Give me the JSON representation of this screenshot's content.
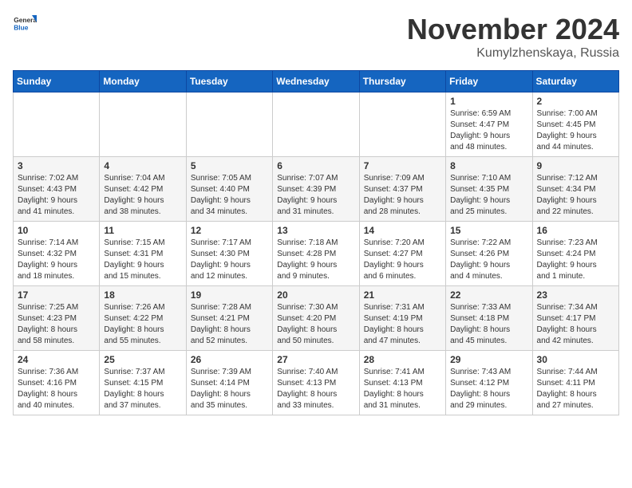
{
  "header": {
    "logo_general": "General",
    "logo_blue": "Blue",
    "month": "November 2024",
    "location": "Kumylzhenskaya, Russia"
  },
  "days_of_week": [
    "Sunday",
    "Monday",
    "Tuesday",
    "Wednesday",
    "Thursday",
    "Friday",
    "Saturday"
  ],
  "weeks": [
    [
      {
        "day": "",
        "info": ""
      },
      {
        "day": "",
        "info": ""
      },
      {
        "day": "",
        "info": ""
      },
      {
        "day": "",
        "info": ""
      },
      {
        "day": "",
        "info": ""
      },
      {
        "day": "1",
        "info": "Sunrise: 6:59 AM\nSunset: 4:47 PM\nDaylight: 9 hours\nand 48 minutes."
      },
      {
        "day": "2",
        "info": "Sunrise: 7:00 AM\nSunset: 4:45 PM\nDaylight: 9 hours\nand 44 minutes."
      }
    ],
    [
      {
        "day": "3",
        "info": "Sunrise: 7:02 AM\nSunset: 4:43 PM\nDaylight: 9 hours\nand 41 minutes."
      },
      {
        "day": "4",
        "info": "Sunrise: 7:04 AM\nSunset: 4:42 PM\nDaylight: 9 hours\nand 38 minutes."
      },
      {
        "day": "5",
        "info": "Sunrise: 7:05 AM\nSunset: 4:40 PM\nDaylight: 9 hours\nand 34 minutes."
      },
      {
        "day": "6",
        "info": "Sunrise: 7:07 AM\nSunset: 4:39 PM\nDaylight: 9 hours\nand 31 minutes."
      },
      {
        "day": "7",
        "info": "Sunrise: 7:09 AM\nSunset: 4:37 PM\nDaylight: 9 hours\nand 28 minutes."
      },
      {
        "day": "8",
        "info": "Sunrise: 7:10 AM\nSunset: 4:35 PM\nDaylight: 9 hours\nand 25 minutes."
      },
      {
        "day": "9",
        "info": "Sunrise: 7:12 AM\nSunset: 4:34 PM\nDaylight: 9 hours\nand 22 minutes."
      }
    ],
    [
      {
        "day": "10",
        "info": "Sunrise: 7:14 AM\nSunset: 4:32 PM\nDaylight: 9 hours\nand 18 minutes."
      },
      {
        "day": "11",
        "info": "Sunrise: 7:15 AM\nSunset: 4:31 PM\nDaylight: 9 hours\nand 15 minutes."
      },
      {
        "day": "12",
        "info": "Sunrise: 7:17 AM\nSunset: 4:30 PM\nDaylight: 9 hours\nand 12 minutes."
      },
      {
        "day": "13",
        "info": "Sunrise: 7:18 AM\nSunset: 4:28 PM\nDaylight: 9 hours\nand 9 minutes."
      },
      {
        "day": "14",
        "info": "Sunrise: 7:20 AM\nSunset: 4:27 PM\nDaylight: 9 hours\nand 6 minutes."
      },
      {
        "day": "15",
        "info": "Sunrise: 7:22 AM\nSunset: 4:26 PM\nDaylight: 9 hours\nand 4 minutes."
      },
      {
        "day": "16",
        "info": "Sunrise: 7:23 AM\nSunset: 4:24 PM\nDaylight: 9 hours\nand 1 minute."
      }
    ],
    [
      {
        "day": "17",
        "info": "Sunrise: 7:25 AM\nSunset: 4:23 PM\nDaylight: 8 hours\nand 58 minutes."
      },
      {
        "day": "18",
        "info": "Sunrise: 7:26 AM\nSunset: 4:22 PM\nDaylight: 8 hours\nand 55 minutes."
      },
      {
        "day": "19",
        "info": "Sunrise: 7:28 AM\nSunset: 4:21 PM\nDaylight: 8 hours\nand 52 minutes."
      },
      {
        "day": "20",
        "info": "Sunrise: 7:30 AM\nSunset: 4:20 PM\nDaylight: 8 hours\nand 50 minutes."
      },
      {
        "day": "21",
        "info": "Sunrise: 7:31 AM\nSunset: 4:19 PM\nDaylight: 8 hours\nand 47 minutes."
      },
      {
        "day": "22",
        "info": "Sunrise: 7:33 AM\nSunset: 4:18 PM\nDaylight: 8 hours\nand 45 minutes."
      },
      {
        "day": "23",
        "info": "Sunrise: 7:34 AM\nSunset: 4:17 PM\nDaylight: 8 hours\nand 42 minutes."
      }
    ],
    [
      {
        "day": "24",
        "info": "Sunrise: 7:36 AM\nSunset: 4:16 PM\nDaylight: 8 hours\nand 40 minutes."
      },
      {
        "day": "25",
        "info": "Sunrise: 7:37 AM\nSunset: 4:15 PM\nDaylight: 8 hours\nand 37 minutes."
      },
      {
        "day": "26",
        "info": "Sunrise: 7:39 AM\nSunset: 4:14 PM\nDaylight: 8 hours\nand 35 minutes."
      },
      {
        "day": "27",
        "info": "Sunrise: 7:40 AM\nSunset: 4:13 PM\nDaylight: 8 hours\nand 33 minutes."
      },
      {
        "day": "28",
        "info": "Sunrise: 7:41 AM\nSunset: 4:13 PM\nDaylight: 8 hours\nand 31 minutes."
      },
      {
        "day": "29",
        "info": "Sunrise: 7:43 AM\nSunset: 4:12 PM\nDaylight: 8 hours\nand 29 minutes."
      },
      {
        "day": "30",
        "info": "Sunrise: 7:44 AM\nSunset: 4:11 PM\nDaylight: 8 hours\nand 27 minutes."
      }
    ]
  ]
}
